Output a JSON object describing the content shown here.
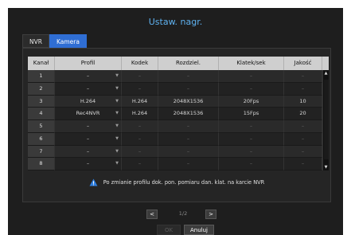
{
  "dialog": {
    "title": "Ustaw. nagr."
  },
  "tabs": [
    {
      "label": "NVR",
      "active": false
    },
    {
      "label": "Kamera",
      "active": true
    }
  ],
  "table": {
    "headers": [
      "Kanał",
      "Profil",
      "Kodek",
      "Rozdziel.",
      "Klatek/sek",
      "Jakość"
    ],
    "rows": [
      {
        "kanal": "1",
        "profil": "–",
        "kodek": "–",
        "rozdziel": "–",
        "klatek": "–",
        "jakosc": "–"
      },
      {
        "kanal": "2",
        "profil": "–",
        "kodek": "–",
        "rozdziel": "–",
        "klatek": "–",
        "jakosc": "–"
      },
      {
        "kanal": "3",
        "profil": "H.264",
        "kodek": "H.264",
        "rozdziel": "2048X1536",
        "klatek": "20Fps",
        "jakosc": "10"
      },
      {
        "kanal": "4",
        "profil": "Rec4NVR",
        "kodek": "H.264",
        "rozdziel": "2048X1536",
        "klatek": "15Fps",
        "jakosc": "20"
      },
      {
        "kanal": "5",
        "profil": "–",
        "kodek": "–",
        "rozdziel": "–",
        "klatek": "–",
        "jakosc": "–"
      },
      {
        "kanal": "6",
        "profil": "–",
        "kodek": "–",
        "rozdziel": "–",
        "klatek": "–",
        "jakosc": "–"
      },
      {
        "kanal": "7",
        "profil": "–",
        "kodek": "–",
        "rozdziel": "–",
        "klatek": "–",
        "jakosc": "–"
      },
      {
        "kanal": "8",
        "profil": "–",
        "kodek": "–",
        "rozdziel": "–",
        "klatek": "–",
        "jakosc": "–"
      }
    ]
  },
  "notice": {
    "icon": "warning-icon",
    "text": "Po zmianie profilu dok. pon. pomiaru dan. klat. na karcie NVR"
  },
  "pager": {
    "prev": "<",
    "page": "1/2",
    "next": ">"
  },
  "buttons": {
    "ok": "OK",
    "cancel": "Anuluj"
  },
  "colors": {
    "accent": "#2f6ed4",
    "title": "#5fb2f0",
    "background": "#1e1e1e"
  }
}
